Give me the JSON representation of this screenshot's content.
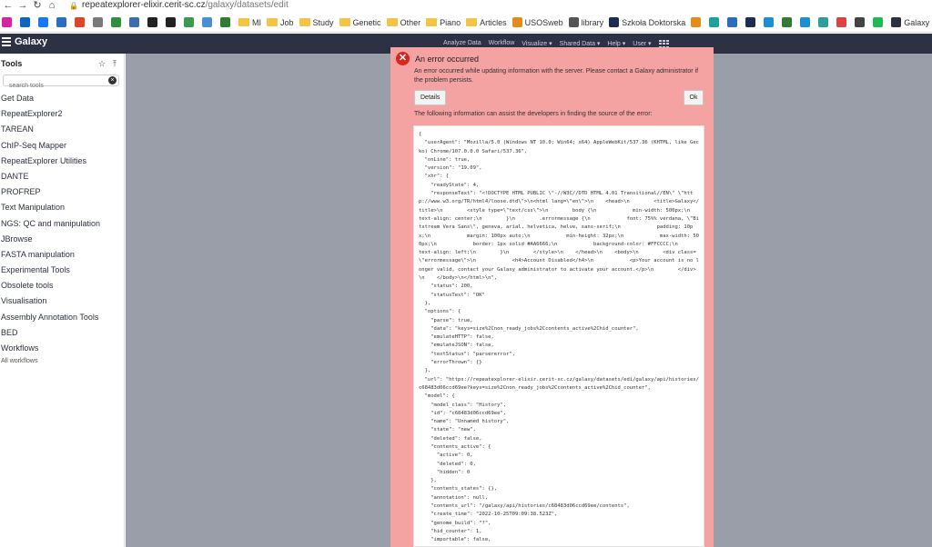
{
  "browser": {
    "url_host": "repeatexplorer-elixir.cerit-sc.cz",
    "url_path": "/galaxy/datasets/edit",
    "bookmarks": [
      {
        "icon": "instagram-icon",
        "color": "#d6249f",
        "label": ""
      },
      {
        "icon": "linkedin-icon",
        "color": "#0a66c2",
        "label": ""
      },
      {
        "icon": "facebook-icon",
        "color": "#1877f2",
        "label": ""
      },
      {
        "icon": "bookmark-icon",
        "color": "#2b6cc4",
        "label": ""
      },
      {
        "icon": "bookmark-icon",
        "color": "#e0442b",
        "label": ""
      },
      {
        "icon": "bookmark-icon",
        "color": "#7a7a7a",
        "label": ""
      },
      {
        "icon": "bookmark-icon",
        "color": "#2f8f3e",
        "label": ""
      },
      {
        "icon": "bookmark-icon",
        "color": "#3b6db0",
        "label": ""
      },
      {
        "icon": "bookmark-icon",
        "color": "#222222",
        "label": ""
      },
      {
        "icon": "bookmark-icon",
        "color": "#222222",
        "label": ""
      },
      {
        "icon": "bookmark-icon",
        "color": "#3c9a4f",
        "label": ""
      },
      {
        "icon": "bookmark-icon",
        "color": "#4a8fd6",
        "label": ""
      },
      {
        "icon": "bookmark-icon",
        "color": "#2e7d32",
        "label": ""
      },
      {
        "icon": "folder-icon",
        "color": "#f4c542",
        "label": "MI"
      },
      {
        "icon": "folder-icon",
        "color": "#f4c542",
        "label": "Job"
      },
      {
        "icon": "folder-icon",
        "color": "#f4c542",
        "label": "Study"
      },
      {
        "icon": "folder-icon",
        "color": "#f4c542",
        "label": "Genetic"
      },
      {
        "icon": "folder-icon",
        "color": "#f4c542",
        "label": "Other"
      },
      {
        "icon": "folder-icon",
        "color": "#f4c542",
        "label": "Piano"
      },
      {
        "icon": "folder-icon",
        "color": "#f4c542",
        "label": "Articles"
      },
      {
        "icon": "usosweb-icon",
        "color": "#e88a18",
        "label": "USOSweb"
      },
      {
        "icon": "library-icon",
        "color": "#555555",
        "label": "library"
      },
      {
        "icon": "szkola-icon",
        "color": "#1b2d55",
        "label": "Szkoła Doktorska"
      },
      {
        "icon": "bookmark-icon",
        "color": "#e88a18",
        "label": ""
      },
      {
        "icon": "bookmark-icon",
        "color": "#1aa39a",
        "label": ""
      },
      {
        "icon": "bookmark-icon",
        "color": "#2b6cc4",
        "label": ""
      },
      {
        "icon": "bookmark-icon",
        "color": "#1b2d55",
        "label": ""
      },
      {
        "icon": "bookmark-icon",
        "color": "#1a8fd6",
        "label": ""
      },
      {
        "icon": "bookmark-icon",
        "color": "#2e7d32",
        "label": ""
      },
      {
        "icon": "bookmark-icon",
        "color": "#1a8fd6",
        "label": ""
      },
      {
        "icon": "bookmark-icon",
        "color": "#2aa198",
        "label": ""
      },
      {
        "icon": "bookmark-icon",
        "color": "#e04040",
        "label": ""
      },
      {
        "icon": "bookmark-icon",
        "color": "#444444",
        "label": ""
      },
      {
        "icon": "spotify-icon",
        "color": "#1db954",
        "label": ""
      },
      {
        "icon": "galaxy-icon",
        "color": "#2c3143",
        "label": "Galaxy"
      }
    ]
  },
  "mast": {
    "brand": "Galaxy",
    "nav": [
      "Analyze Data",
      "Workflow",
      "Visualize ▾",
      "Shared Data ▾",
      "Help ▾",
      "User ▾"
    ]
  },
  "tools": {
    "title": "Tools",
    "search_placeholder": "search tools",
    "items": [
      "Get Data",
      "RepeatExplorer2",
      "TAREAN",
      "ChIP-Seq Mapper",
      "RepeatExplorer Utilities",
      "DANTE",
      "PROFREP",
      "Text Manipulation",
      "NGS: QC and manipulation",
      "JBrowse",
      "FASTA manipulation",
      "Experimental Tools",
      "Obsolete tools",
      "Visualisation",
      "Assembly Annotation Tools",
      "BED",
      "Workflows"
    ],
    "all_workflows": "All workflows"
  },
  "modal": {
    "title": "An error occurred",
    "message": "An error occurred while updating information with the server. Please contact a Galaxy administrator if the problem persists.",
    "details_label": "Details",
    "ok_label": "Ok",
    "info": "The following information can assist the developers in finding the source of the error:",
    "error_json": "{\n  \"userAgent\": \"Mozilla/5.0 (Windows NT 10.0; Win64; x64) AppleWebKit/537.36 (KHTML, like Gecko) Chrome/107.0.0.0 Safari/537.36\",\n  \"onLine\": true,\n  \"version\": \"19.09\",\n  \"xhr\": {\n    \"readyState\": 4,\n    \"responseText\": \"<!DOCTYPE HTML PUBLIC \\\"-//W3C//DTD HTML 4.01 Transitional//EN\\\" \\\"http://www.w3.org/TR/html4/loose.dtd\\\">\\n<html lang=\\\"en\\\">\\n    <head>\\n        <title>Galaxy</title>\\n        <style type=\\\"text/css\\\">\\n        body {\\n            min-width: 500px;\\n            text-align: center;\\n        }\\n        .errormessage {\\n            font: 75%% verdana, \\\"Bitstream Vera Sans\\\", geneva, arial, helvetica, helve, sans-serif;\\n            padding: 10px;\\n            margin: 100px auto;\\n            min-height: 32px;\\n            max-width: 500px;\\n            border: 1px solid #AA6666;\\n            background-color: #FFCCCC;\\n            text-align: left;\\n        }\\n        </style>\\n    </head>\\n    <body>\\n        <div class=\\\"errormessage\\\">\\n            <h4>Account Disabled</h4>\\n            <p>Your account is no longer valid, contact your Galaxy administrator to activate your account.</p>\\n        </div>\\n    </body>\\n</html>\\n\",\n    \"status\": 200,\n    \"statusText\": \"OK\"\n  },\n  \"options\": {\n    \"parse\": true,\n    \"data\": \"keys=size%2Cnon_ready_jobs%2Ccontents_active%2Chid_counter\",\n    \"emulateHTTP\": false,\n    \"emulateJSON\": false,\n    \"textStatus\": \"parsererror\",\n    \"errorThrown\": {}\n  },\n  \"url\": \"https://repeatexplorer-elixir.cerit-sc.cz/galaxy/datasets/edi/galaxy/api/histories/c68483d06ccd69ee?keys=size%2Cnon_ready_jobs%2Ccontents_active%2Chid_counter\",\n  \"model\": {\n    \"model_class\": \"History\",\n    \"id\": \"c68483d06ccd69ee\",\n    \"name\": \"Unnamed history\",\n    \"state\": \"new\",\n    \"deleted\": false,\n    \"contents_active\": {\n      \"active\": 0,\n      \"deleted\": 0,\n      \"hidden\": 0\n    },\n    \"contents_states\": {},\n    \"annotation\": null,\n    \"contents_url\": \"/galaxy/api/histories/c68483d06ccd69ee/contents\",\n    \"create_time\": \"2022-10-25T09:09:38.523Z\",\n    \"genome_build\": \"?\",\n    \"hid_counter\": 1,\n    \"importable\": false,"
  }
}
